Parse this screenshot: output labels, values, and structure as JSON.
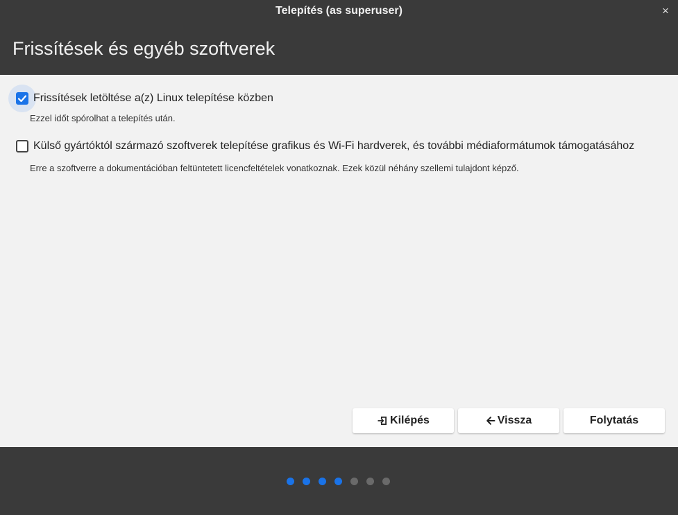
{
  "window": {
    "title": "Telepítés (as superuser)",
    "close_glyph": "×"
  },
  "header": {
    "title": "Frissítések és egyéb szoftverek"
  },
  "options": [
    {
      "label": "Frissítések letöltése a(z) Linux telepítése közben",
      "description": "Ezzel időt spórolhat a telepítés után.",
      "checked": true
    },
    {
      "label": "Külső gyártóktól származó szoftverek telepítése grafikus és Wi-Fi hardverek, és további médiaformátumok támogatásához",
      "description": "Erre a szoftverre a dokumentációban feltüntetett licencfeltételek vonatkoznak. Ezek közül néhány szellemi tulajdont képző.",
      "checked": false
    }
  ],
  "buttons": {
    "quit": {
      "label": "Kilépés",
      "icon": "exit-icon"
    },
    "back": {
      "label": "Vissza",
      "icon": "arrow-left-icon"
    },
    "continue": {
      "label": "Folytatás"
    }
  },
  "progress": {
    "total_steps": 7,
    "completed_steps": 4
  },
  "colors": {
    "accent": "#1a73e8",
    "chrome": "#3a3a3a",
    "content_bg": "#f2f2f2",
    "inactive_dot": "#6a6a6a"
  }
}
